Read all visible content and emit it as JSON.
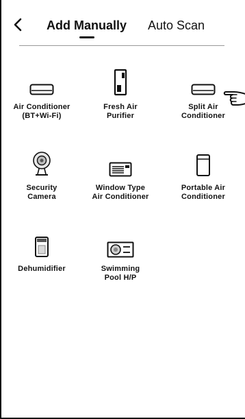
{
  "header": {
    "back_icon": "chevron-left-icon",
    "tabs": [
      {
        "label": "Add Manually",
        "active": true
      },
      {
        "label": "Auto Scan",
        "active": false
      }
    ]
  },
  "devices": [
    {
      "label_line1": "Air Conditioner",
      "label_line2": "(BT+Wi-Fi)",
      "icon": "air-conditioner-icon"
    },
    {
      "label_line1": "Fresh Air",
      "label_line2": "Purifier",
      "icon": "fresh-air-purifier-icon"
    },
    {
      "label_line1": "Split Air",
      "label_line2": "Conditioner",
      "icon": "split-air-conditioner-icon"
    },
    {
      "label_line1": "Security",
      "label_line2": "Camera",
      "icon": "security-camera-icon"
    },
    {
      "label_line1": "Window Type",
      "label_line2": "Air Conditioner",
      "icon": "window-air-conditioner-icon"
    },
    {
      "label_line1": "Portable Air",
      "label_line2": "Conditioner",
      "icon": "portable-air-conditioner-icon"
    },
    {
      "label_line1": "Dehumidifier",
      "label_line2": "",
      "icon": "dehumidifier-icon"
    },
    {
      "label_line1": "Swimming",
      "label_line2": "Pool H/P",
      "icon": "pool-heat-pump-icon"
    }
  ],
  "pointer": "hand-pointer-icon"
}
